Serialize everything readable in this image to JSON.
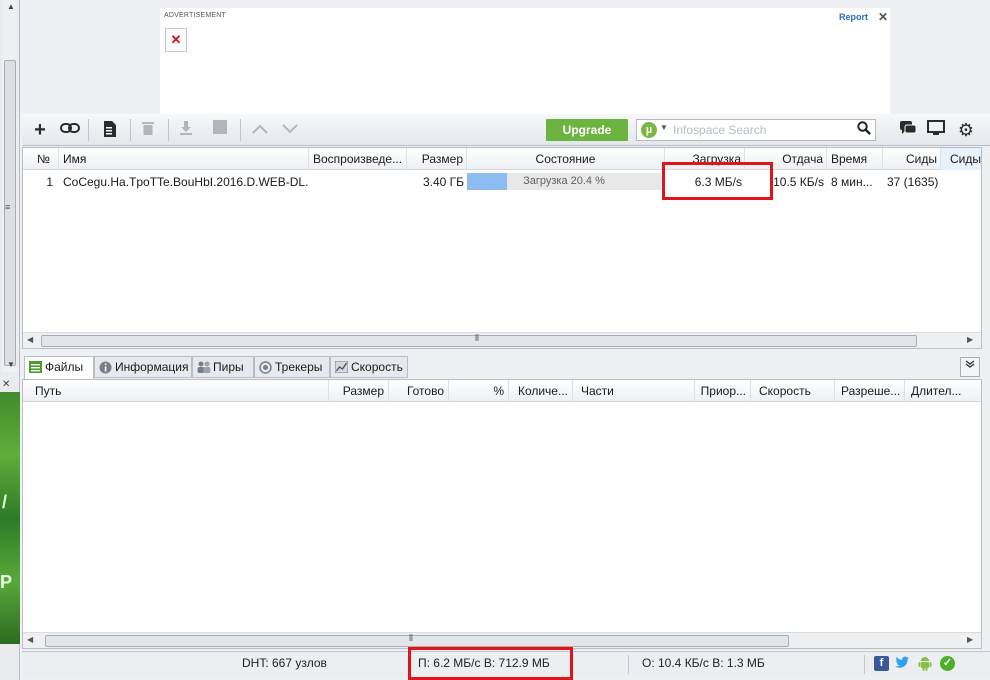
{
  "ad": {
    "label": "ADVERTISEMENT",
    "report": "Report",
    "close": "✕",
    "broken_image": "✕"
  },
  "toolbar": {
    "add": "+",
    "add_link": "🔗",
    "create": "📄",
    "remove": "🗑",
    "start": "⬇",
    "stop": "■",
    "up": "︿",
    "down": "﹀",
    "upgrade": "Upgrade",
    "search_placeholder": "Infospace Search",
    "search_logo": "µ",
    "chat": "💬",
    "remote": "🖥",
    "settings": "⚙"
  },
  "torrents": {
    "columns": [
      "№",
      "Имя",
      "Воспроизведе...",
      "Размер",
      "Состояние",
      "Загрузка",
      "Отдача",
      "Время",
      "Сиды",
      "Сиды"
    ],
    "rows": [
      {
        "num": "1",
        "name": "CoCegu.Ha.TpoTTe.BouHbI.2016.D.WEB-DL...",
        "play": "",
        "size": "3.40 ГБ",
        "status": "Загрузка 20.4 %",
        "progress": 0.204,
        "download": "6.3 МБ/s",
        "upload": "10.5 КБ/s",
        "eta": "8 мин...",
        "seeds": "37 (1635)"
      }
    ]
  },
  "tabs": [
    {
      "label": "Файлы",
      "icon": "files-icon",
      "active": true
    },
    {
      "label": "Информация",
      "icon": "info-icon",
      "active": false
    },
    {
      "label": "Пиры",
      "icon": "peers-icon",
      "active": false
    },
    {
      "label": "Трекеры",
      "icon": "trackers-icon",
      "active": false
    },
    {
      "label": "Скорость",
      "icon": "speed-icon",
      "active": false
    }
  ],
  "files": {
    "columns": [
      "Путь",
      "Размер",
      "Готово",
      "%",
      "Количе...",
      "Части",
      "Приор...",
      "Скорость",
      "Разреше...",
      "Длител..."
    ]
  },
  "status": {
    "dht": "DHT: 667 узлов",
    "download": "П: 6.2 МБ/с В: 712.9 МБ",
    "upload": "О: 10.4 КБ/с В: 1.3 МБ"
  },
  "left_promo": {
    "text_1": "/",
    "text_2": "P"
  },
  "colors": {
    "highlight": "#e1141a",
    "upgrade": "#6cb33f",
    "progress_fill": "#8dbdf0"
  }
}
